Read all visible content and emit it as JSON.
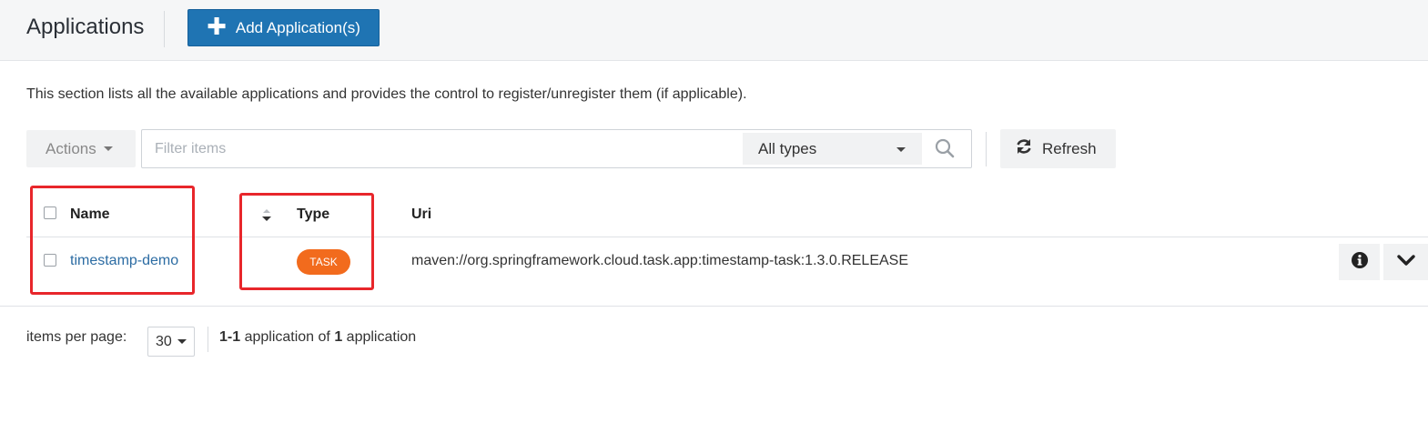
{
  "header": {
    "title": "Applications",
    "add_button_label": "Add Application(s)"
  },
  "description": "This section lists all the available applications and provides the control to register/unregister them (if applicable).",
  "toolbar": {
    "actions_label": "Actions",
    "filter_placeholder": "Filter items",
    "type_select_value": "All types",
    "refresh_label": "Refresh"
  },
  "table": {
    "columns": [
      "Name",
      "Type",
      "Uri"
    ],
    "rows": [
      {
        "name": "timestamp-demo",
        "type": "TASK",
        "uri": "maven://org.springframework.cloud.task.app:timestamp-task:1.3.0.RELEASE"
      }
    ]
  },
  "pagination": {
    "items_per_page_label": "items per page:",
    "items_per_page_value": "30",
    "range": "1-1",
    "middle_text": " application of ",
    "total": "1",
    "suffix": " application"
  },
  "colors": {
    "primary": "#1f74b3",
    "task_badge": "#f26b1d",
    "link": "#2c6ca3",
    "highlight": "#e8262b"
  }
}
